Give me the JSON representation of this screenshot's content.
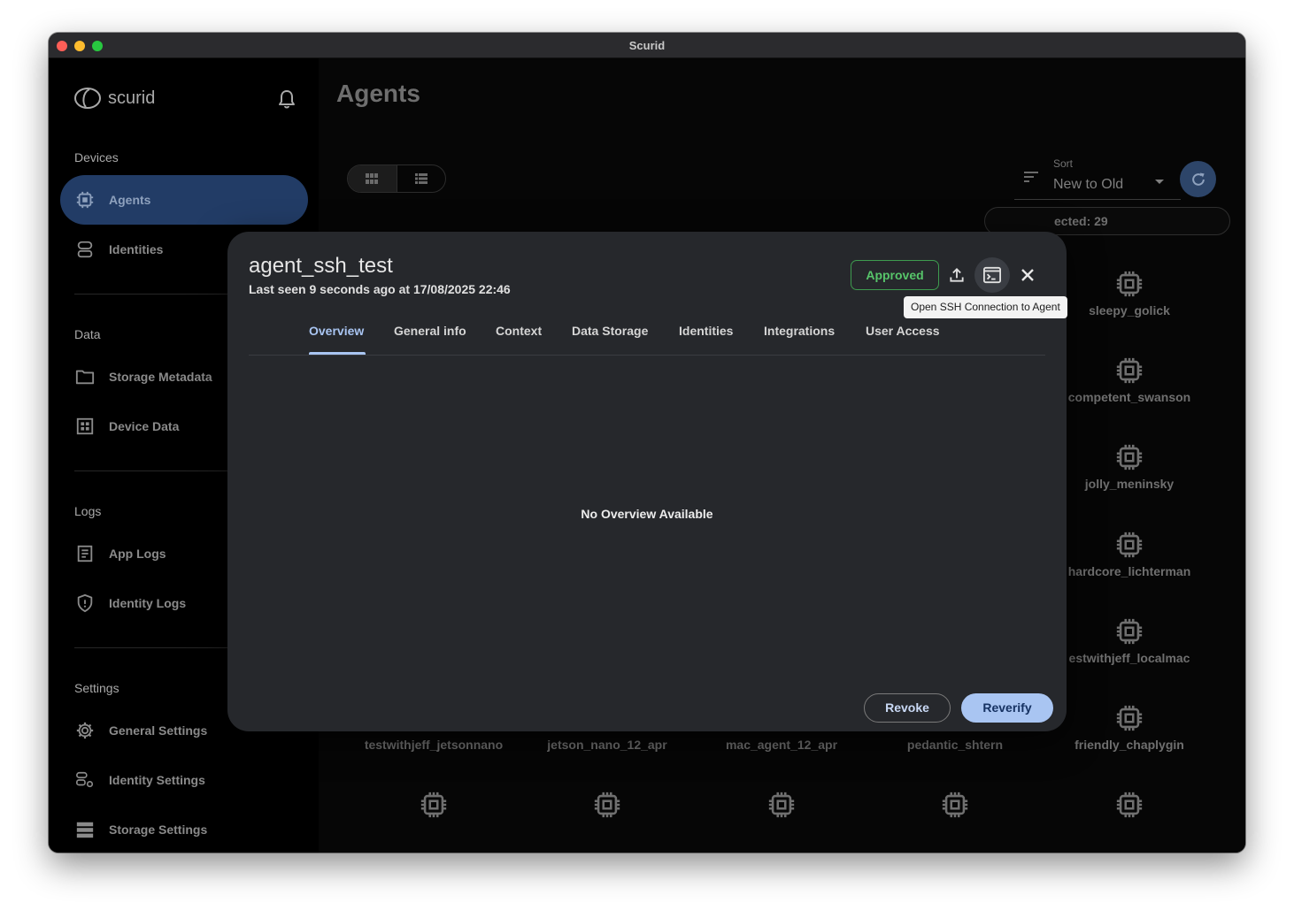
{
  "window": {
    "title": "Scurid"
  },
  "sidebar": {
    "logo_text": "scurid",
    "sections": {
      "devices": "Devices",
      "data": "Data",
      "logs": "Logs",
      "settings": "Settings"
    },
    "items": {
      "agents": "Agents",
      "identities": "Identities",
      "storage_metadata": "Storage Metadata",
      "device_data": "Device Data",
      "app_logs": "App Logs",
      "identity_logs": "Identity Logs",
      "general_settings": "General Settings",
      "identity_settings": "Identity Settings",
      "storage_settings": "Storage Settings"
    }
  },
  "main": {
    "title": "Agents",
    "sort": {
      "label": "Sort",
      "value": "New to Old"
    },
    "selected_chip": "ected: 29",
    "agents": {
      "sleepy_golick": "sleepy_golick",
      "competent_swanson": "competent_swanson",
      "jolly_meninsky": "jolly_meninsky",
      "hardcore_lichterman": "hardcore_lichterman",
      "testwithjeff_localmac": "estwithjeff_localmac",
      "testwithjeff_jetsonnano": "testwithjeff_jetsonnano",
      "jetson_nano_12_apr": "jetson_nano_12_apr",
      "mac_agent_12_apr": "mac_agent_12_apr",
      "pedantic_shtern": "pedantic_shtern",
      "friendly_chaplygin": "friendly_chaplygin"
    }
  },
  "modal": {
    "title": "agent_ssh_test",
    "subtitle": "Last seen 9 seconds ago at 17/08/2025 22:46",
    "status": "Approved",
    "tooltip": "Open SSH Connection to Agent",
    "tabs": {
      "overview": "Overview",
      "general_info": "General info",
      "context": "Context",
      "data_storage": "Data Storage",
      "identities": "Identities",
      "integrations": "Integrations",
      "user_access": "User Access"
    },
    "empty_message": "No Overview Available",
    "revoke": "Revoke",
    "reverify": "Reverify"
  }
}
